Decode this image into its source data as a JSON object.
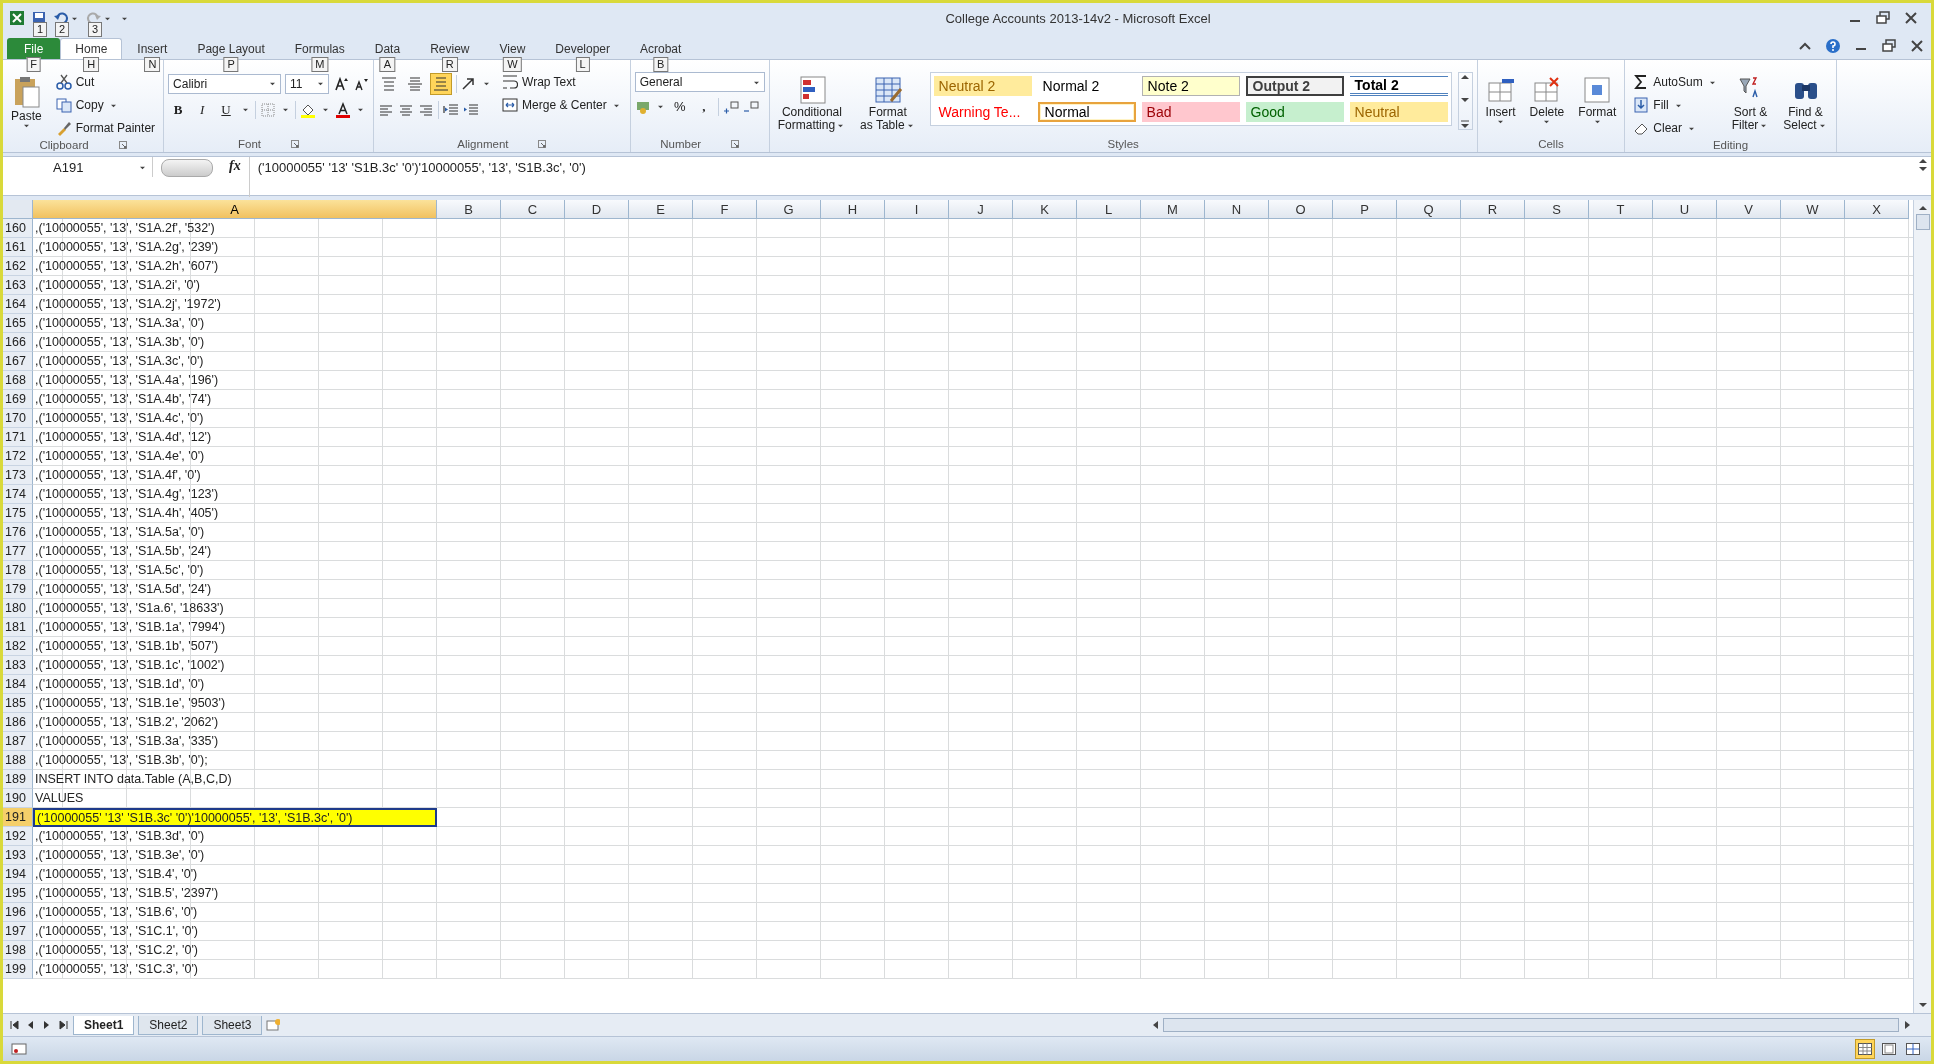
{
  "window": {
    "title": "College Accounts 2013-14v2  -  Microsoft Excel",
    "quick_access_key_tips": [
      "1",
      "2",
      "3"
    ]
  },
  "tabs": [
    {
      "label": "File",
      "key_tip": "F",
      "kind": "file",
      "selected": false
    },
    {
      "label": "Home",
      "key_tip": "H",
      "kind": "tab",
      "selected": true
    },
    {
      "label": "Insert",
      "key_tip": "N",
      "kind": "tab",
      "selected": false
    },
    {
      "label": "Page Layout",
      "key_tip": "P",
      "kind": "tab",
      "selected": false
    },
    {
      "label": "Formulas",
      "key_tip": "M",
      "kind": "tab",
      "selected": false
    },
    {
      "label": "Data",
      "key_tip": "A",
      "kind": "tab",
      "selected": false
    },
    {
      "label": "Review",
      "key_tip": "R",
      "kind": "tab",
      "selected": false
    },
    {
      "label": "View",
      "key_tip": "W",
      "kind": "tab",
      "selected": false
    },
    {
      "label": "Developer",
      "key_tip": "L",
      "kind": "tab",
      "selected": false
    },
    {
      "label": "Acrobat",
      "key_tip": "B",
      "kind": "tab",
      "selected": false
    }
  ],
  "ribbon": {
    "groups": [
      {
        "kind": "clipboard",
        "label": "Clipboard",
        "launcher": true,
        "paste": "Paste",
        "small": [
          {
            "label": "Cut",
            "dropdown": false
          },
          {
            "label": "Copy",
            "dropdown": true
          },
          {
            "label": "Format Painter",
            "dropdown": false
          }
        ]
      },
      {
        "kind": "font",
        "label": "Font",
        "launcher": true,
        "font": "Calibri",
        "size": "11",
        "bold": "B",
        "italic": "I",
        "underline": "U"
      },
      {
        "kind": "alignment",
        "label": "Alignment",
        "launcher": true,
        "vertical_align": [
          {
            "selected": false
          },
          {
            "selected": false
          },
          {
            "selected": true
          }
        ],
        "wrap": "Wrap Text",
        "merge": "Merge & Center"
      },
      {
        "kind": "number",
        "label": "Number",
        "launcher": true,
        "format": "General",
        "percent": "%",
        "comma": ","
      },
      {
        "kind": "styles",
        "label": "Styles",
        "launcher": false,
        "conditional": [
          "Conditional",
          "Formatting"
        ],
        "gallery_scroll": true,
        "table": [
          "Format",
          "as Table"
        ],
        "gallery": [
          {
            "label": "Neutral 2",
            "kind": "neutral",
            "selected": false
          },
          {
            "label": "Normal 2",
            "kind": "normal",
            "selected": false
          },
          {
            "label": "Note 2",
            "kind": "note",
            "selected": false
          },
          {
            "label": "Output 2",
            "kind": "output",
            "selected": false
          },
          {
            "label": "Total 2",
            "kind": "total",
            "selected": false
          },
          {
            "label": "Warning Te...",
            "kind": "warning",
            "selected": false
          },
          {
            "label": "Normal",
            "kind": "normal",
            "selected": true
          },
          {
            "label": "Bad",
            "kind": "bad",
            "selected": false
          },
          {
            "label": "Good",
            "kind": "good",
            "selected": false
          },
          {
            "label": "Neutral",
            "kind": "neutral",
            "selected": false
          }
        ]
      },
      {
        "kind": "cells",
        "label": "Cells",
        "launcher": false,
        "buttons": [
          "Insert",
          "Delete",
          "Format"
        ]
      },
      {
        "kind": "editing",
        "label": "Editing",
        "launcher": false,
        "small": [
          "AutoSum",
          "Fill",
          "Clear"
        ],
        "large": [
          [
            "Sort &",
            "Filter"
          ],
          [
            "Find &",
            "Select"
          ]
        ]
      }
    ]
  },
  "formula_bar": {
    "name_box": "A191",
    "function_label": "fx",
    "formula": "('10000055' '13' 'S1B.3c' '0')'10000055', '13', 'S1B.3c', '0')"
  },
  "columns": [
    {
      "label": "A",
      "selected": true
    },
    {
      "label": "B",
      "selected": false
    },
    {
      "label": "C",
      "selected": false
    },
    {
      "label": "D",
      "selected": false
    },
    {
      "label": "E",
      "selected": false
    },
    {
      "label": "F",
      "selected": false
    },
    {
      "label": "G",
      "selected": false
    },
    {
      "label": "H",
      "selected": false
    },
    {
      "label": "I",
      "selected": false
    },
    {
      "label": "J",
      "selected": false
    },
    {
      "label": "K",
      "selected": false
    },
    {
      "label": "L",
      "selected": false
    },
    {
      "label": "M",
      "selected": false
    },
    {
      "label": "N",
      "selected": false
    },
    {
      "label": "O",
      "selected": false
    },
    {
      "label": "P",
      "selected": false
    },
    {
      "label": "Q",
      "selected": false
    },
    {
      "label": "R",
      "selected": false
    },
    {
      "label": "S",
      "selected": false
    },
    {
      "label": "T",
      "selected": false
    },
    {
      "label": "U",
      "selected": false
    },
    {
      "label": "V",
      "selected": false
    },
    {
      "label": "W",
      "selected": false
    },
    {
      "label": "X",
      "selected": false
    }
  ],
  "rows": [
    {
      "number": "160",
      "value": ",('10000055', '13', 'S1A.2f', '532')",
      "selected": false
    },
    {
      "number": "161",
      "value": ",('10000055', '13', 'S1A.2g', '239')",
      "selected": false
    },
    {
      "number": "162",
      "value": ",('10000055', '13', 'S1A.2h', '607')",
      "selected": false
    },
    {
      "number": "163",
      "value": ",('10000055', '13', 'S1A.2i', '0')",
      "selected": false
    },
    {
      "number": "164",
      "value": ",('10000055', '13', 'S1A.2j', '1972')",
      "selected": false
    },
    {
      "number": "165",
      "value": ",('10000055', '13', 'S1A.3a', '0')",
      "selected": false
    },
    {
      "number": "166",
      "value": ",('10000055', '13', 'S1A.3b', '0')",
      "selected": false
    },
    {
      "number": "167",
      "value": ",('10000055', '13', 'S1A.3c', '0')",
      "selected": false
    },
    {
      "number": "168",
      "value": ",('10000055', '13', 'S1A.4a', '196')",
      "selected": false
    },
    {
      "number": "169",
      "value": ",('10000055', '13', 'S1A.4b', '74')",
      "selected": false
    },
    {
      "number": "170",
      "value": ",('10000055', '13', 'S1A.4c', '0')",
      "selected": false
    },
    {
      "number": "171",
      "value": ",('10000055', '13', 'S1A.4d', '12')",
      "selected": false
    },
    {
      "number": "172",
      "value": ",('10000055', '13', 'S1A.4e', '0')",
      "selected": false
    },
    {
      "number": "173",
      "value": ",('10000055', '13', 'S1A.4f', '0')",
      "selected": false
    },
    {
      "number": "174",
      "value": ",('10000055', '13', 'S1A.4g', '123')",
      "selected": false
    },
    {
      "number": "175",
      "value": ",('10000055', '13', 'S1A.4h', '405')",
      "selected": false
    },
    {
      "number": "176",
      "value": ",('10000055', '13', 'S1A.5a', '0')",
      "selected": false
    },
    {
      "number": "177",
      "value": ",('10000055', '13', 'S1A.5b', '24')",
      "selected": false
    },
    {
      "number": "178",
      "value": ",('10000055', '13', 'S1A.5c', '0')",
      "selected": false
    },
    {
      "number": "179",
      "value": ",('10000055', '13', 'S1A.5d', '24')",
      "selected": false
    },
    {
      "number": "180",
      "value": ",('10000055', '13', 'S1a.6', '18633')",
      "selected": false
    },
    {
      "number": "181",
      "value": ",('10000055', '13', 'S1B.1a', '7994')",
      "selected": false
    },
    {
      "number": "182",
      "value": ",('10000055', '13', 'S1B.1b', '507')",
      "selected": false
    },
    {
      "number": "183",
      "value": ",('10000055', '13', 'S1B.1c', '1002')",
      "selected": false
    },
    {
      "number": "184",
      "value": ",('10000055', '13', 'S1B.1d', '0')",
      "selected": false
    },
    {
      "number": "185",
      "value": ",('10000055', '13', 'S1B.1e', '9503')",
      "selected": false
    },
    {
      "number": "186",
      "value": ",('10000055', '13', 'S1B.2', '2062')",
      "selected": false
    },
    {
      "number": "187",
      "value": ",('10000055', '13', 'S1B.3a', '335')",
      "selected": false
    },
    {
      "number": "188",
      "value": ",('10000055', '13', 'S1B.3b', '0');",
      "selected": false
    },
    {
      "number": "189",
      "value": "INSERT INTO data.Table (A,B,C,D)",
      "selected": false
    },
    {
      "number": "190",
      "value": "VALUES",
      "selected": false
    },
    {
      "number": "191",
      "value": "('10000055' '13' 'S1B.3c' '0')'10000055', '13', 'S1B.3c', '0')",
      "selected": true
    },
    {
      "number": "192",
      "value": ",('10000055', '13', 'S1B.3d', '0')",
      "selected": false
    },
    {
      "number": "193",
      "value": ",('10000055', '13', 'S1B.3e', '0')",
      "selected": false
    },
    {
      "number": "194",
      "value": ",('10000055', '13', 'S1B.4', '0')",
      "selected": false
    },
    {
      "number": "195",
      "value": ",('10000055', '13', 'S1B.5', '2397')",
      "selected": false
    },
    {
      "number": "196",
      "value": ",('10000055', '13', 'S1B.6', '0')",
      "selected": false
    },
    {
      "number": "197",
      "value": ",('10000055', '13', 'S1C.1', '0')",
      "selected": false
    },
    {
      "number": "198",
      "value": ",('10000055', '13', 'S1C.2', '0')",
      "selected": false
    },
    {
      "number": "199",
      "value": ",('10000055', '13', 'S1C.3', '0')",
      "selected": false
    }
  ],
  "sheets": [
    {
      "name": "Sheet1",
      "selected": true
    },
    {
      "name": "Sheet2",
      "selected": false
    },
    {
      "name": "Sheet3",
      "selected": false
    }
  ],
  "status_bar": {
    "views": [
      {
        "selected": true
      },
      {
        "selected": false
      },
      {
        "selected": false
      }
    ]
  }
}
